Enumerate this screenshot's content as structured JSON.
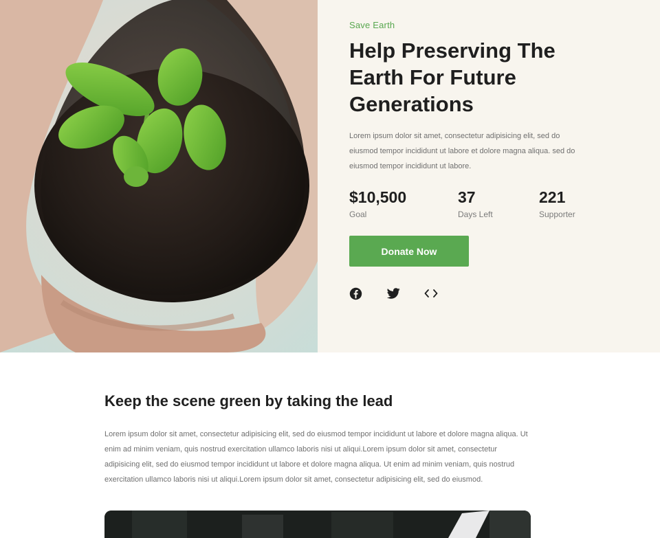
{
  "hero": {
    "eyebrow": "Save Earth",
    "title": "Help Preserving The Earth For Future Generations",
    "description": "Lorem ipsum dolor sit amet, consectetur adipisicing elit, sed do eiusmod tempor incididunt ut labore et dolore magna aliqua. sed do eiusmod tempor incididunt ut labore.",
    "stats": {
      "goal": {
        "value": "$10,500",
        "label": "Goal"
      },
      "days_left": {
        "value": "37",
        "label": "Days Left"
      },
      "supporter": {
        "value": "221",
        "label": "Supporter"
      }
    },
    "donate_label": "Donate Now",
    "social_icons": [
      "facebook-icon",
      "twitter-icon",
      "code-embed-icon"
    ]
  },
  "section": {
    "title": "Keep the scene green by taking the lead",
    "body": "Lorem ipsum dolor sit amet, consectetur adipisicing elit, sed do eiusmod tempor incididunt ut labore et dolore magna aliqua. Ut enim ad minim veniam, quis nostrud exercitation ullamco laboris nisi ut aliqui.Lorem ipsum dolor sit amet, consectetur adipisicing elit, sed do eiusmod tempor incididunt ut labore et dolore magna aliqua. Ut enim ad minim veniam, quis nostrud exercitation ullamco laboris nisi ut aliqui.Lorem ipsum dolor sit amet, consectetur adipisicing elit, sed do eiusmod."
  },
  "colors": {
    "accent": "#5aa951",
    "panel_background": "#f8f5ee",
    "heading": "#1f1f1f",
    "body_text": "#6f6f6f"
  }
}
